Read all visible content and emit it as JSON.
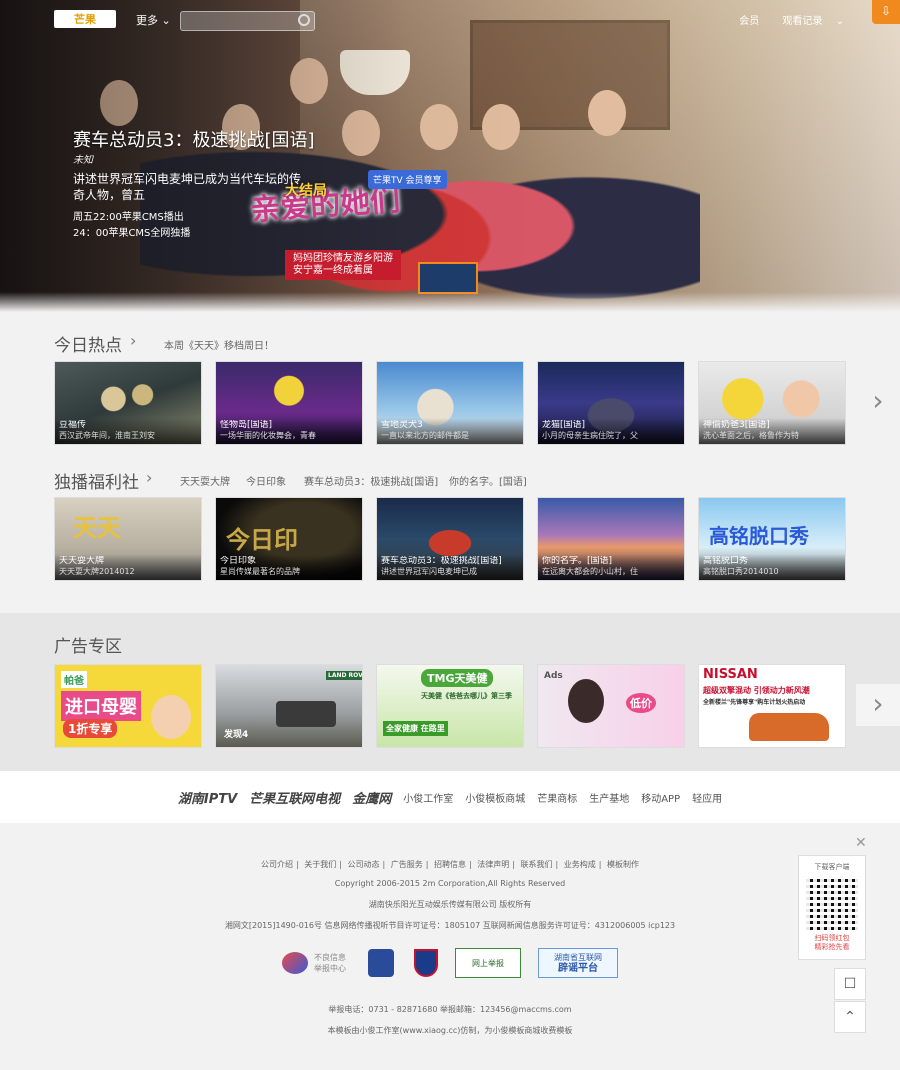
{
  "header": {
    "logo_text": "芒果",
    "more_label": "更多",
    "search_placeholder": "",
    "member_label": "会员",
    "history_label": "观看记录"
  },
  "hero": {
    "title": "赛车总动员3：极速挑战[国语]",
    "subtitle": "未知",
    "description": "讲述世界冠军闪电麦坤已成为当代车坛的传奇人物，曾五",
    "time_line1": "周五22:00苹果CMS播出",
    "time_line2": "24：00苹果CMS全网独播",
    "art_title": "亲爱的她们",
    "art_tag1": "妈妈团珍情友游乡阳游",
    "art_tag2": "安宁嘉一终成着属",
    "art_badge": "芒果TV 会员尊享",
    "art_top": "大结局"
  },
  "today": {
    "title": "今日热点",
    "note": "本周《天天》移档周日！",
    "items": [
      {
        "title": "豆福传",
        "desc": "西汉武帝年间，淮南王刘安"
      },
      {
        "title": "怪物岛[国语]",
        "desc": "一场华丽的化妆舞会，青春"
      },
      {
        "title": "雪地灵犬3",
        "desc": "一直以来北方的邮件都是"
      },
      {
        "title": "龙猫[国语]",
        "desc": "小月的母亲生病住院了，父"
      },
      {
        "title": "神偷奶爸3[国语]",
        "desc": "洗心革面之后，格鲁作为特"
      }
    ]
  },
  "exclusive": {
    "title": "独播福利社",
    "links": [
      "天天耍大牌",
      "今日印象",
      "赛车总动员3：极速挑战[国语]",
      "你的名字。[国语]"
    ],
    "items": [
      {
        "title": "天天耍大牌",
        "desc": "天天耍大牌2014012"
      },
      {
        "title": "今日印象",
        "desc": "星尚传媒最著名的品牌"
      },
      {
        "title": "赛车总动员3：极速挑战[国语]",
        "desc": "讲述世界冠军闪电麦坤已成"
      },
      {
        "title": "你的名字。[国语]",
        "desc": "在远离大都会的小山村，住"
      },
      {
        "title": "高铭脱口秀",
        "desc": "高铭脱口秀2014010"
      }
    ]
  },
  "ads": {
    "title": "广告专区",
    "items": [
      {
        "line1": "帕爸",
        "line2": "进口母婴",
        "line3": "1折专享"
      },
      {
        "line1": "LAND ROVER",
        "line2": "发现4",
        "line3": ""
      },
      {
        "line1": "TMG天美健",
        "line2": "天美健《爸爸去哪儿》第三季",
        "line3": "全家健康 在路里"
      },
      {
        "line1": "Ads",
        "line2": "低价",
        "line3": ""
      },
      {
        "line1": "NISSAN",
        "line2": "超级双擎混动 引领动力新风潮",
        "line3": "全新楼兰\"先锋尊享\"购车计划火热启动"
      }
    ]
  },
  "partners": {
    "brands": [
      "湖南IPTV",
      "芒果互联网电视",
      "金鹰网"
    ],
    "links": [
      "小俊工作室",
      "小俊模板商城",
      "芒果商标",
      "生产基地",
      "移动APP",
      "轻应用"
    ]
  },
  "footer": {
    "links": [
      "公司介绍",
      "关于我们",
      "公司动态",
      "广告服务",
      "招聘信息",
      "法律声明",
      "联系我们",
      "业务构成",
      "模板制作"
    ],
    "copyright": "Copyright 2006-2015 2m Corporation,All Rights Reserved",
    "company": "湖南快乐阳光互动娱乐传媒有限公司 版权所有",
    "license": "湘网文[2015]1490-016号 信息网络传播视听节目许可证号：1805107 互联网新闻信息服务许可证号：4312006005 icp123",
    "badge1_line1": "不良信息",
    "badge1_line2": "举报中心",
    "badge4": "网上举报",
    "badge5_line1": "湖南省互联网",
    "badge5_line2": "辟谣平台",
    "report": "举报电话：0731 - 82871680 举报邮箱：123456@maccms.com",
    "made_by": "本模板由小俊工作室(www.xiaog.cc)仿制，为小俊模板商城收费模板"
  },
  "sidebar": {
    "qr_title": "下载客户端",
    "qr_line1": "扫码领红包",
    "qr_line2": "精彩抢先看"
  }
}
